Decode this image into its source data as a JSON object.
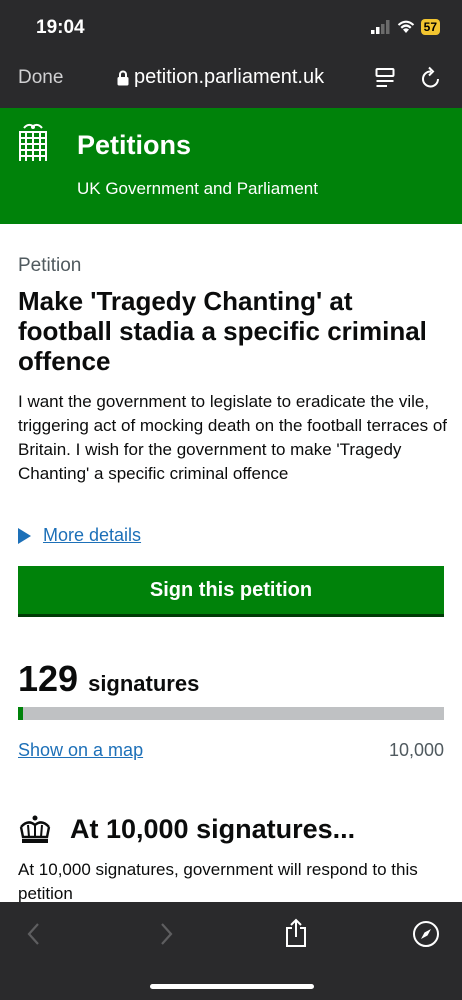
{
  "status_bar": {
    "time": "19:04",
    "battery": "57"
  },
  "browser": {
    "done_label": "Done",
    "url": "petition.parliament.uk"
  },
  "header": {
    "title": "Petitions",
    "subtitle": "UK Government and Parliament"
  },
  "petition": {
    "caption": "Petition",
    "title": "Make 'Tragedy Chanting' at football stadia a specific criminal offence",
    "description": "I want the government to legislate to eradicate the vile, triggering act of mocking death on the football terraces of Britain. I wish for the government to make 'Tragedy Chanting' a specific criminal offence",
    "more_details_label": "More details",
    "sign_button_label": "Sign this petition"
  },
  "signatures": {
    "count": "129",
    "label": "signatures",
    "progress_fraction": 0.0129,
    "show_map_label": "Show on a map",
    "target": "10,000"
  },
  "threshold": {
    "title": "At 10,000 signatures...",
    "text": "At 10,000 signatures, government will respond to this petition"
  },
  "toolbar": {
    "icons": [
      "back-icon",
      "forward-icon",
      "share-icon",
      "compass-icon"
    ]
  },
  "colors": {
    "gov_green": "#00820a",
    "link_blue": "#1d70b8",
    "chrome_dark": "#2a2a2c"
  }
}
